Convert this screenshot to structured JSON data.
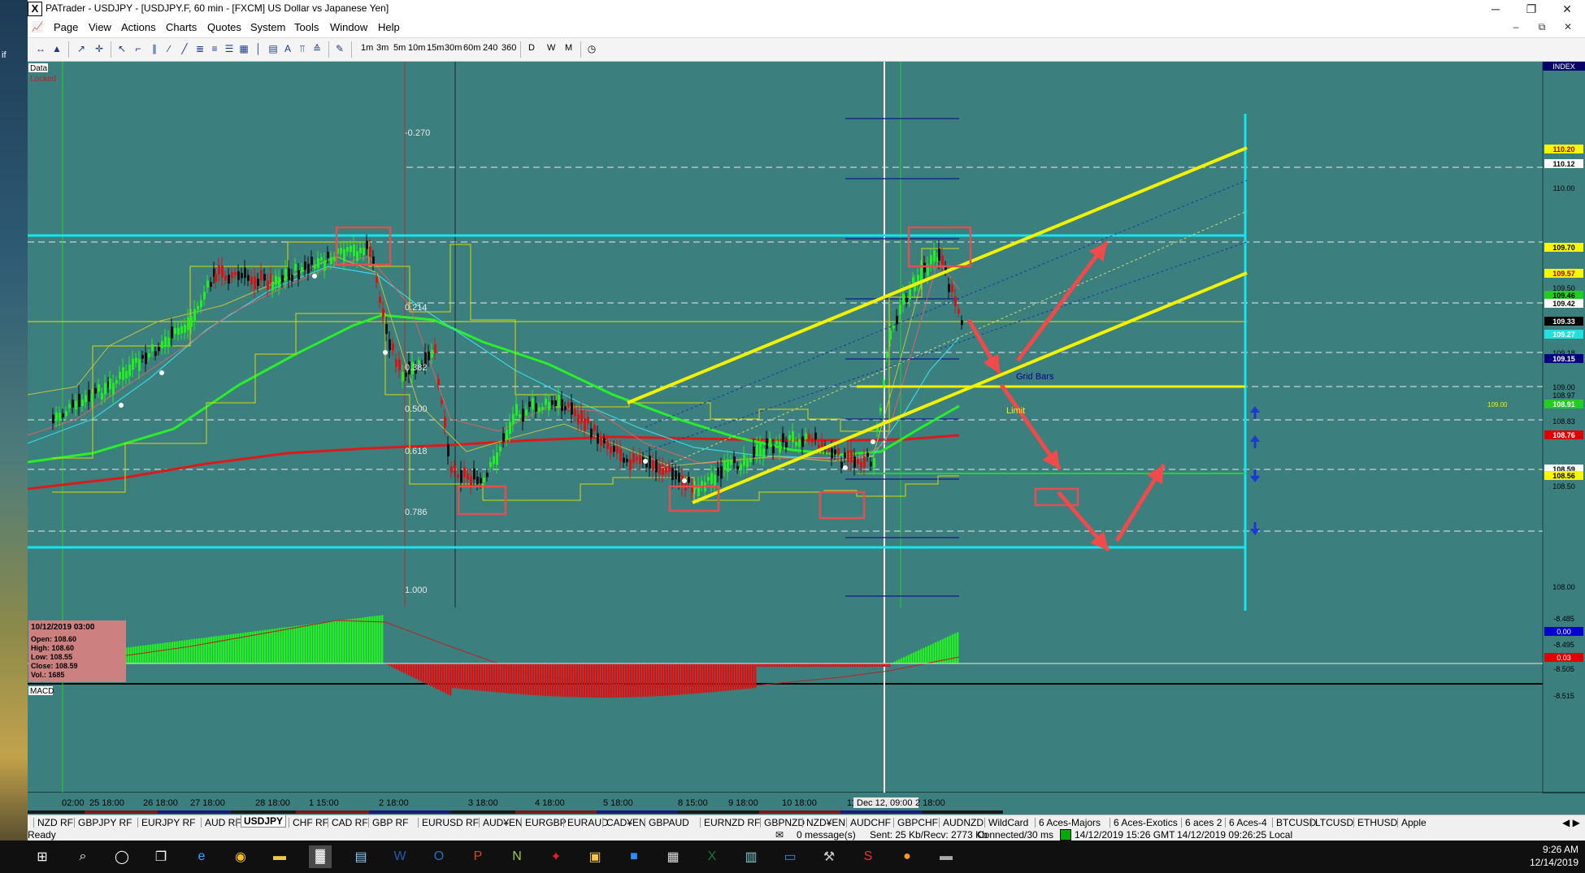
{
  "window": {
    "title": "PATrader - USDJPY - [USDJPY.F, 60 min - [FXCM] US Dollar vs Japanese Yen]",
    "app_icon": "X"
  },
  "desktop": {
    "left_time": "AM",
    "left_year": "2019",
    "side_text": "if"
  },
  "menu": [
    "Page",
    "View",
    "Actions",
    "Charts",
    "Quotes",
    "System",
    "Tools",
    "Window",
    "Help"
  ],
  "toolbar": {
    "timeframes": [
      "1m",
      "3m",
      "5m",
      "10m",
      "15m",
      "30m",
      "60m",
      "240",
      "360",
      "D",
      "W",
      "M"
    ]
  },
  "chart": {
    "data_label": "Data",
    "locked_label": "Locked",
    "index_label": "INDEX",
    "fib_levels": [
      "-0.270",
      "0.214",
      "0.382",
      "0.500",
      "0.618",
      "0.786",
      "1.000"
    ],
    "annotations": {
      "grid_bars": "Grid Bars",
      "limit": "Limit",
      "limit_price": "109.00"
    },
    "price_axis": {
      "plain": [
        "110.00",
        "109.50",
        "109.18",
        "109.00",
        "108.97",
        "108.83",
        "108.50",
        "108.00"
      ],
      "highlight": [
        {
          "label": "110.20",
          "bg": "#f7f700",
          "fg": "#b00000"
        },
        {
          "label": "110.12",
          "bg": "#ffffff",
          "fg": "#000000"
        },
        {
          "label": "109.70",
          "bg": "#f7f700",
          "fg": "#000000"
        },
        {
          "label": "109.57",
          "bg": "#f7f700",
          "fg": "#b00000"
        },
        {
          "label": "109.46",
          "bg": "#22cc22",
          "fg": "#000000"
        },
        {
          "label": "109.42",
          "bg": "#ffffff",
          "fg": "#000000"
        },
        {
          "label": "109.33",
          "bg": "#000000",
          "fg": "#ffffff"
        },
        {
          "label": "109.27",
          "bg": "#22e0e0",
          "fg": "#ffffff"
        },
        {
          "label": "109.15",
          "bg": "#000080",
          "fg": "#ffffff"
        },
        {
          "label": "108.91",
          "bg": "#22cc22",
          "fg": "#ffffff"
        },
        {
          "label": "108.76",
          "bg": "#dd0000",
          "fg": "#ffffff"
        },
        {
          "label": "108.59",
          "bg": "#ffffff",
          "fg": "#000000"
        },
        {
          "label": "108.56",
          "bg": "#f7f700",
          "fg": "#000000"
        }
      ]
    },
    "time_axis": [
      "02:00",
      "25 18:00",
      "26 18:00",
      "27 18:00",
      "28 18:00",
      "1 15:00",
      "2 18:00",
      "3 18:00",
      "4 18:00",
      "5 18:00",
      "8 15:00",
      "9 18:00",
      "10 18:00",
      "11",
      "Dec 12, 09:00",
      "2 18:00"
    ],
    "info_box": {
      "datetime": "10/12/2019 03:00",
      "open": "Open: 108.60",
      "high": "High: 108.60",
      "low": "Low: 108.55",
      "close": "Close: 108.59",
      "vol": "Vol.: 1685"
    },
    "macd": {
      "label": "MACD",
      "axis": [
        "-8.485",
        "-8.495",
        "-8.505",
        "-8.515"
      ],
      "tags": [
        {
          "label": "0.00",
          "bg": "#0000cc",
          "fg": "#ffffff"
        },
        {
          "label": "0.03",
          "bg": "#dd0000",
          "fg": "#ffffff"
        }
      ]
    },
    "colors": {
      "background": "#3b7f7f",
      "bull": "#22ee22",
      "bear": "#dd1111",
      "trend": "#f2f200",
      "cyan": "#17e4ee",
      "arrow": "#f04a4a"
    }
  },
  "tabs": [
    "NZD RF",
    "GBPJPY RF",
    "EURJPY RF",
    "AUD RF",
    "USDJPY",
    "CHF RF",
    "CAD RF",
    "GBP RF",
    "EURUSD RF",
    "AUD¥EN",
    "EURGBP",
    "EURAUD",
    "CAD¥EN",
    "GBPAUD",
    "EURNZD RF",
    "GBPNZD",
    "NZD¥EN",
    "AUDCHF",
    "GBPCHF",
    "AUDNZD",
    "WildCard",
    "6 Aces-Majors",
    "6 Aces-Exotics",
    "6 aces 2",
    "6 Aces-4",
    "BTCUSD",
    "LTCUSD",
    "ETHUSD",
    "Apple"
  ],
  "active_tab": "USDJPY",
  "status": {
    "ready": "Ready",
    "messages": "0 message(s)",
    "traffic": "Sent: 25 Kb/Recv: 2773 Kb",
    "connection": "Connected/30 ms",
    "gmt_time": "14/12/2019 15:26 GMT",
    "local_time": "14/12/2019 09:26:25 Local"
  },
  "taskbar": {
    "time": "9:26 AM",
    "date": "12/14/2019"
  }
}
